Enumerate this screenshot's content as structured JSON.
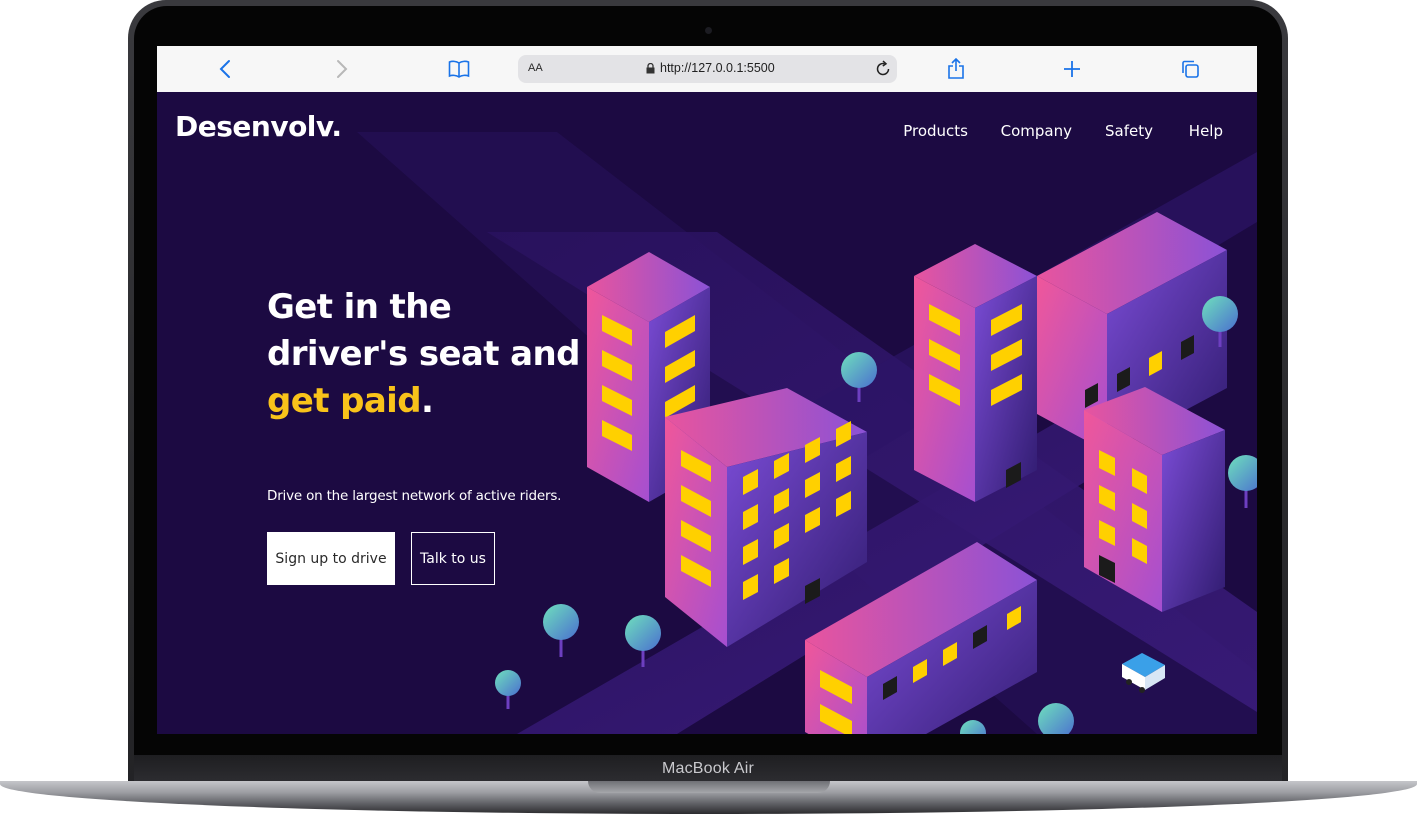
{
  "device": {
    "model_label": "MacBook Air"
  },
  "browser": {
    "text_size_label": "AA",
    "url": "http://127.0.0.1:5500",
    "icons": [
      "back-icon",
      "forward-icon",
      "bookmarks-icon",
      "lock-icon",
      "reload-icon",
      "share-icon",
      "new-tab-icon",
      "tabs-icon"
    ]
  },
  "site": {
    "logo": "Desenvolv.",
    "nav": [
      "Products",
      "Company",
      "Safety",
      "Help"
    ]
  },
  "hero": {
    "title_line1": "Get in the",
    "title_line2": "driver's seat and",
    "title_accent": "get paid",
    "title_end": ".",
    "subtitle": "Drive on the largest network of active riders.",
    "primary_cta": "Sign up to drive",
    "secondary_cta": "Talk to us"
  },
  "colors": {
    "background": "#1c0a42",
    "accent": "#f9c31a",
    "building_pink": "#e0539a",
    "building_purple": "#6a3fc0",
    "window_yellow": "#ffd000",
    "tree": "#5fc7b3"
  }
}
